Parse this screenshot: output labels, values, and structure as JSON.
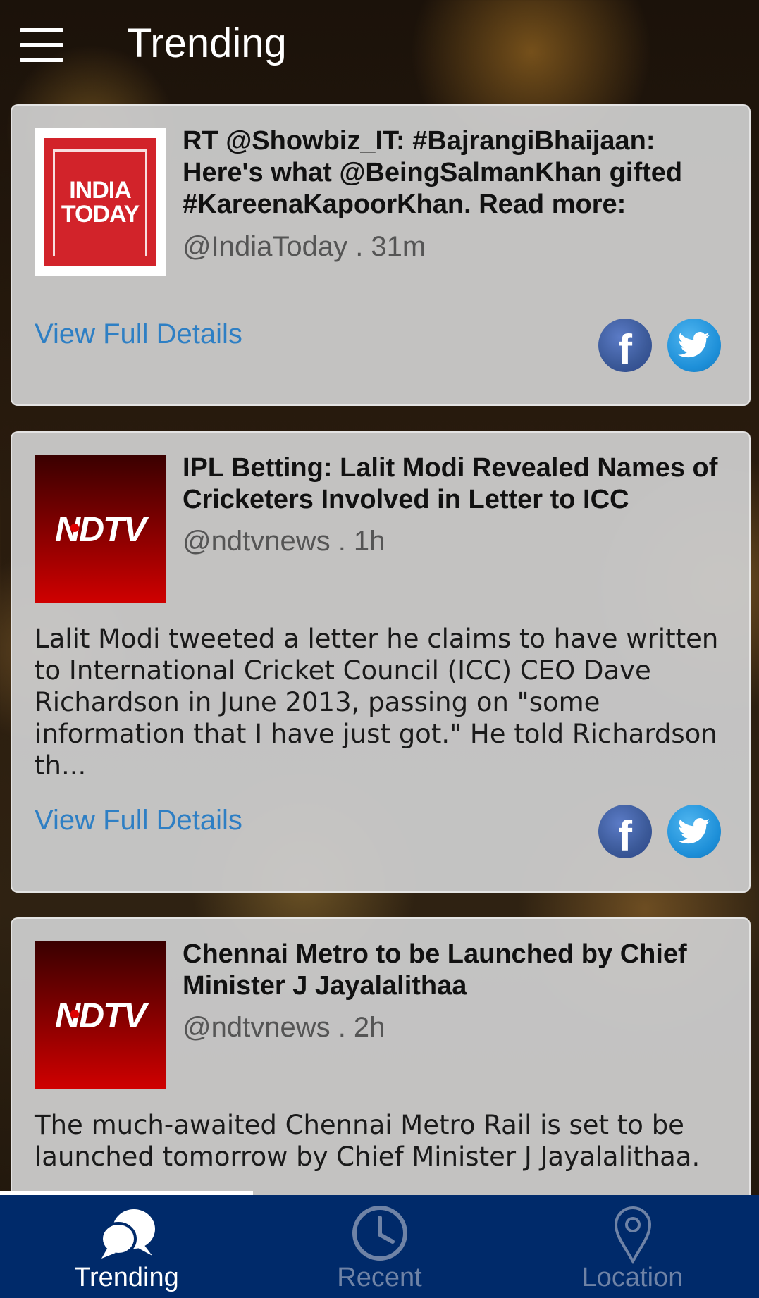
{
  "header": {
    "title": "Trending"
  },
  "feed": [
    {
      "logo_text": "INDIA TODAY",
      "headline": "RT @Showbiz_IT: #BajrangiBhaijaan: Here's what @BeingSalmanKhan gifted #KareenaKapoorKhan. Read more:",
      "source": "@IndiaToday . 31m",
      "summary": "",
      "link": "View Full Details",
      "share_icons": [
        "facebook-icon",
        "twitter-icon"
      ]
    },
    {
      "logo_text": "NDTV",
      "headline": "IPL Betting: Lalit Modi Revealed Names of Cricketers Involved in Letter to ICC",
      "source": "@ndtvnews . 1h",
      "summary": "Lalit Modi tweeted a letter he claims to have written to International Cricket Council (ICC) CEO Dave Richardson in June 2013, passing on \"some information that I have just got.\" He told Richardson th...",
      "link": "View Full Details",
      "share_icons": [
        "facebook-icon",
        "twitter-icon"
      ]
    },
    {
      "logo_text": "NDTV",
      "headline": "Chennai Metro to be Launched by Chief Minister J Jayalalithaa",
      "source": "@ndtvnews . 2h",
      "summary": "The much-awaited Chennai Metro Rail is set to be launched tomorrow by Chief Minister J Jayalalithaa."
    }
  ],
  "tabs": [
    {
      "label": "Trending",
      "icon": "chat-bubbles-icon",
      "active": true
    },
    {
      "label": "Recent",
      "icon": "clock-icon",
      "active": false
    },
    {
      "label": "Location",
      "icon": "map-pin-icon",
      "active": false
    }
  ],
  "colors": {
    "tab_bar": "#002a6a",
    "link": "#2e7fc4",
    "facebook": "#3b5998",
    "twitter": "#1d8fd8",
    "india_today_red": "#d2232a",
    "ndtv_red": "#c00000"
  }
}
